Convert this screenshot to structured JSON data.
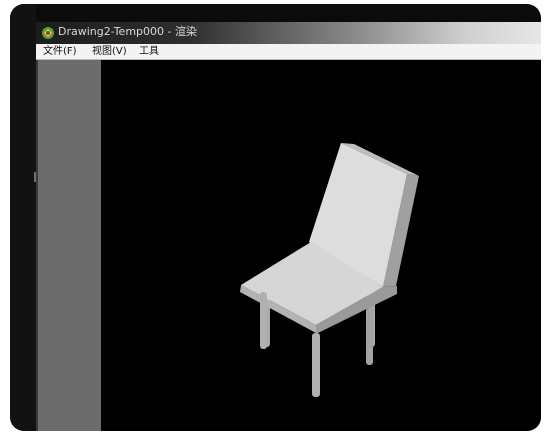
{
  "window": {
    "title": "Drawing2-Temp000 - 渲染"
  },
  "menu": {
    "items": [
      {
        "label": "文件(F)"
      },
      {
        "label": "视图(V)"
      },
      {
        "label": "工具"
      }
    ]
  },
  "viewport": {
    "background": "#000000",
    "model": "chair",
    "model_colors": {
      "light_face": "#d9d9d9",
      "mid_face": "#b8b8b8",
      "dark_face": "#9a9a9a",
      "legs": "#a9a9a9"
    }
  },
  "panel": {
    "color": "#6c6c6c"
  }
}
